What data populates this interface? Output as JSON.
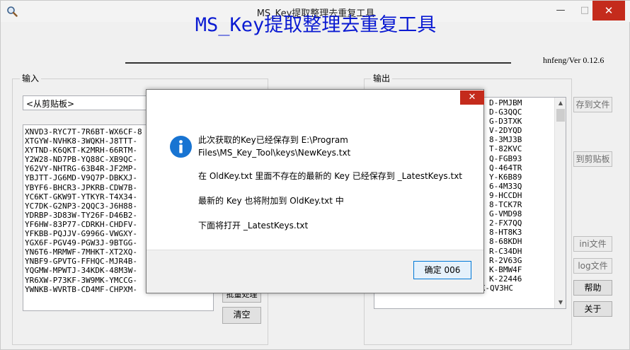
{
  "window": {
    "title": "MS_Key提取整理去重复工具",
    "controls": {
      "minimize": "—",
      "maximize": "□",
      "close": "✕"
    }
  },
  "header": {
    "heading": "MS_Key提取整理去重复工具",
    "version": "hnfeng/Ver 0.12.6"
  },
  "input": {
    "group_label": "输入",
    "source_value": "<从剪贴板>",
    "lines": [
      "XNVD3-RYC7T-7R6BT-WX6CF-8",
      "XTGYW-NVHK8-3WQKH-J8TTT-",
      "XYTND-K6QKT-K2MRH-66RTM-",
      "Y2W28-ND7PB-YQ88C-XB9QC-",
      "Y62VY-NHTRG-63B4R-JF2MP-",
      "YBJTT-JG6MD-V9Q7P-DBKXJ-",
      "YBYF6-BHCR3-JPKRB-CDW7B-",
      "YC6KT-GKW9T-YTKYR-T4X34-",
      "YC7DK-G2NP3-2QQC3-J6H88-",
      "YDRBP-3D83W-TY26F-D46B2-",
      "YF6HW-83P77-CDRKH-CHDFV-",
      "YFKBB-PQJJV-G996G-VWGXY-",
      "YGX6F-PGV49-PGW3J-9BTGG-",
      "YN6T6-MRMWF-7MHKT-XT2XQ-",
      "YNBF9-GPVTG-FFHQC-MJR4B-",
      "YQGMW-MPWTJ-34KDK-48M3W-",
      "YR6XW-P73KF-3W9MK-YMCCG-",
      "YWNKB-WVRTB-CD4MF-CHPXM-"
    ],
    "extract_label": "批量处理",
    "clear_label": "清空"
  },
  "output": {
    "group_label": "输出",
    "lines": [
      "D-PMJBM",
      "D-G3QQC",
      "G-D3TXK",
      "V-2DYQD",
      "8-3MJ3B",
      "T-82KVC",
      "Q-FGB93",
      "Q-464TR",
      "Y-K6B89",
      "6-4M33Q",
      "9-HCCDH",
      "8-TCK7R",
      "G-VMD98",
      "2-FX7QQ",
      "8-HT8K3",
      "8-68KDH",
      "R-C34DH",
      "R-2V63G",
      "K-BMW4F",
      "K-22446"
    ],
    "last_line": "2VNV4-77CKK-GRDM3-4FPQK-QV3HC"
  },
  "side_buttons": {
    "save_file": "存到文件",
    "to_clipboard": "到剪贴板",
    "ini": "ini文件",
    "log": "log文件",
    "help": "帮助",
    "about": "关于"
  },
  "dialog": {
    "close": "✕",
    "icon": "info-icon",
    "line1": "此次获取的Key已经保存到 E:\\Program",
    "line2": "Files\\MS_Key_Tool\\keys\\NewKeys.txt",
    "line3": "在 OldKey.txt 里面不存在的最新的 Key 已经保存到 _LatestKeys.txt",
    "line4": "最新的 Key 也将附加到 OldKey.txt 中",
    "line5": "下面将打开 _LatestKeys.txt",
    "ok_label": "确定 006"
  },
  "colors": {
    "heading": "#0a1ad2",
    "close_red": "#c42b1c",
    "info_blue": "#1874d2",
    "ok_border": "#0078d7"
  }
}
